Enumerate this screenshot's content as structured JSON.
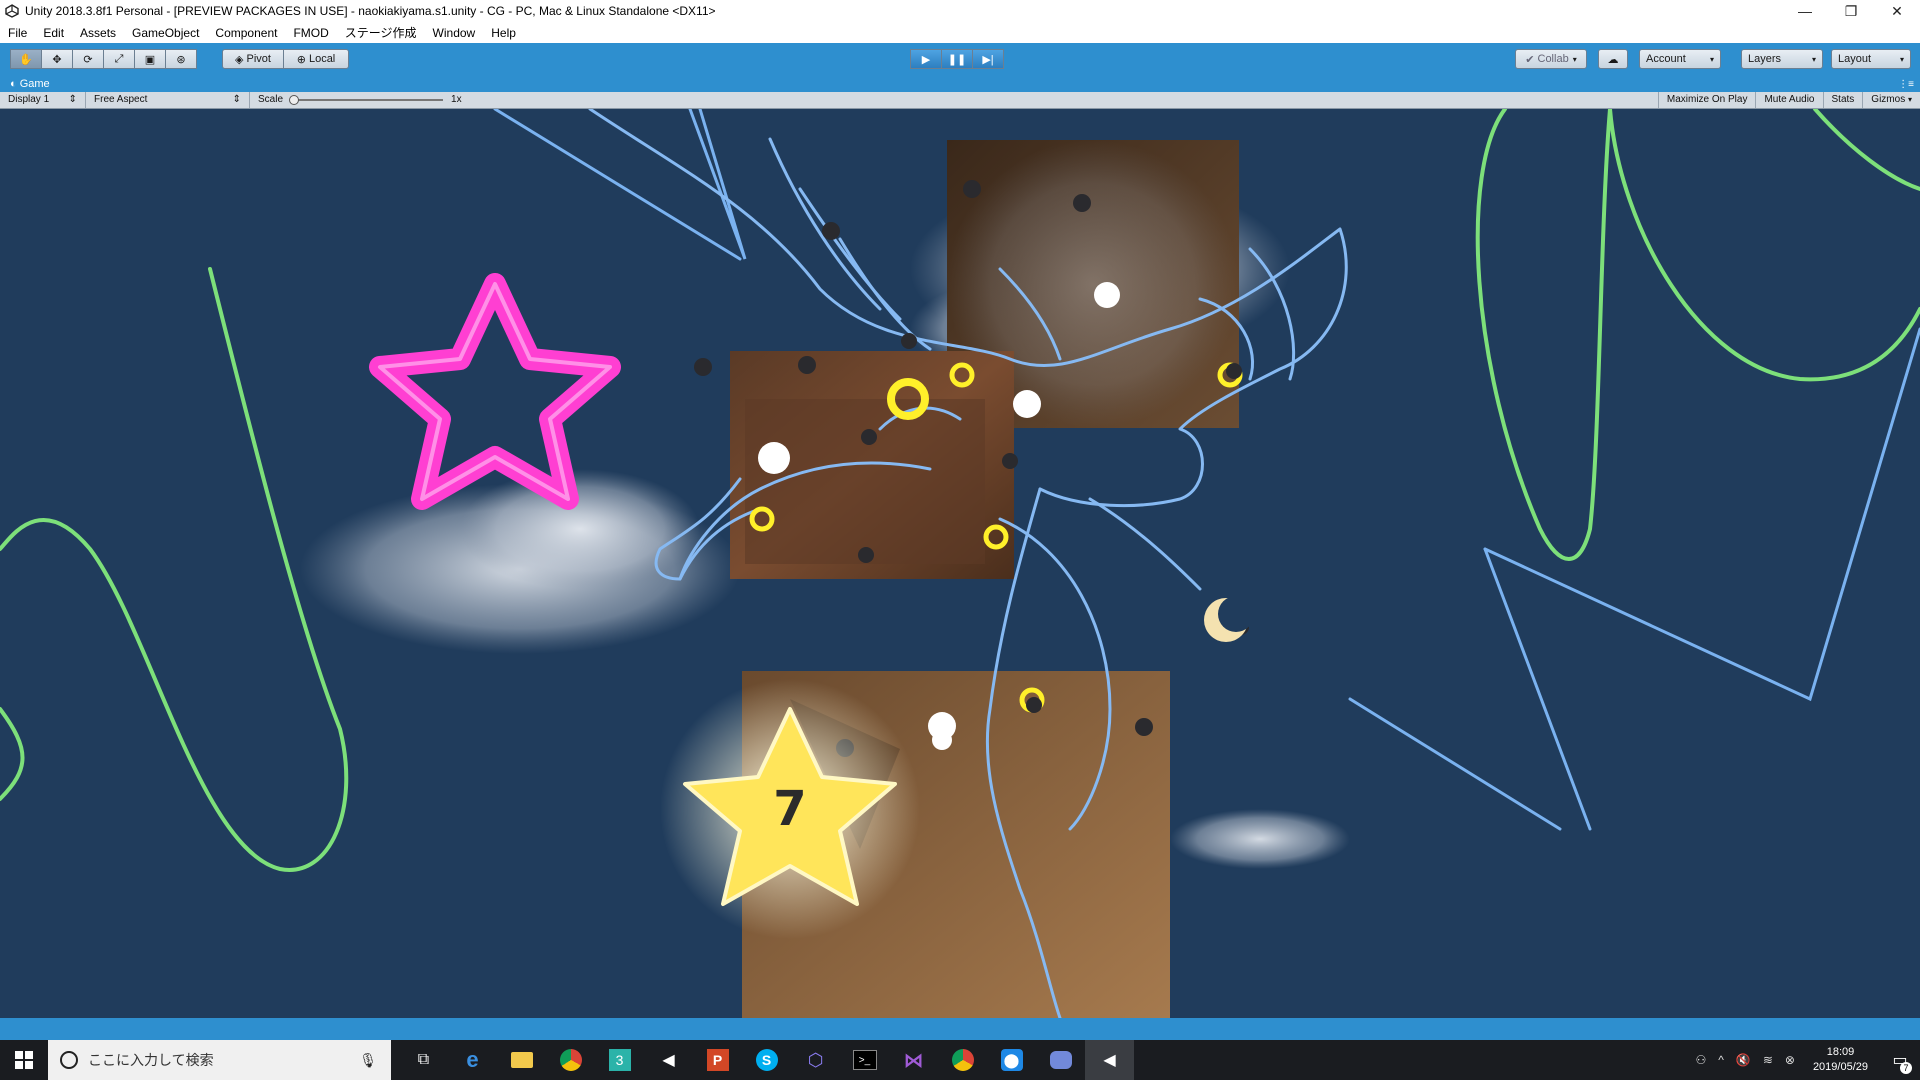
{
  "window": {
    "title": "Unity 2018.3.8f1 Personal - [PREVIEW PACKAGES IN USE] - naokiakiyama.s1.unity - CG - PC, Mac & Linux Standalone <DX11>",
    "minimize": "—",
    "restore": "❐",
    "close": "✕"
  },
  "menu": [
    "File",
    "Edit",
    "Assets",
    "GameObject",
    "Component",
    "FMOD",
    "ステージ作成",
    "Window",
    "Help"
  ],
  "toolbar": {
    "pivot": "Pivot",
    "local": "Local",
    "collab": "Collab",
    "account": "Account",
    "layers": "Layers",
    "layout": "Layout"
  },
  "game_tab": {
    "label": "Game"
  },
  "game_options": {
    "display": "Display 1",
    "aspect": "Free Aspect",
    "scale_label": "Scale",
    "scale_value": "1x",
    "maximize": "Maximize On Play",
    "mute": "Mute Audio",
    "stats": "Stats",
    "gizmos": "Gizmos"
  },
  "scene": {
    "star_number": "7"
  },
  "taskbar": {
    "search_placeholder": "ここに入力して検索",
    "time": "18:09",
    "date": "2019/05/29",
    "notification_count": "7"
  }
}
